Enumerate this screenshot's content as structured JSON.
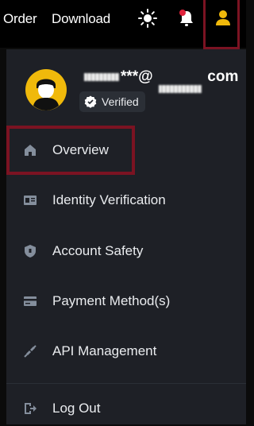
{
  "topbar": {
    "order_label": "Order",
    "download_label": "Download",
    "icons": [
      "sun-icon",
      "bell-icon",
      "user-icon"
    ]
  },
  "profile": {
    "email_prefix": "***@",
    "email_suffix": "com",
    "verified_label": "Verified"
  },
  "menu": {
    "items": [
      {
        "label": "Overview",
        "icon": "home-icon"
      },
      {
        "label": "Identity Verification",
        "icon": "id-card-icon"
      },
      {
        "label": "Account Safety",
        "icon": "shield-icon"
      },
      {
        "label": "Payment Method(s)",
        "icon": "card-icon"
      },
      {
        "label": "API Management",
        "icon": "api-icon"
      },
      {
        "label": "Log Out",
        "icon": "logout-icon"
      }
    ]
  },
  "colors": {
    "accent": "#f0b90b",
    "highlight_border": "#7b1322",
    "menu_bg": "#1e2026",
    "topbar_bg": "#000000"
  }
}
